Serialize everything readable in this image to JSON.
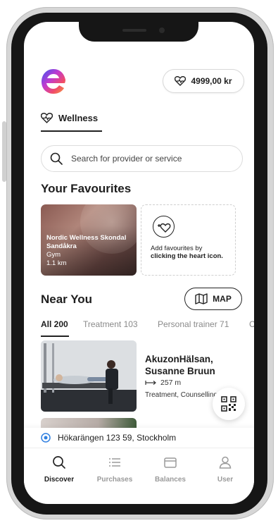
{
  "header": {
    "balance": "4999,00 kr",
    "category_tab": "Wellness"
  },
  "search": {
    "placeholder": "Search for provider or service"
  },
  "favourites": {
    "heading": "Your Favourites",
    "cards": [
      {
        "name": "Nordic Wellness Skondal Sandåkra",
        "type": "Gym",
        "distance": "1.1 km"
      }
    ],
    "add_card": {
      "text": "Add favourites by",
      "bold_text": "clicking the heart icon."
    }
  },
  "near_you": {
    "heading": "Near You",
    "map_label": "MAP",
    "filters": [
      {
        "label": "All 200",
        "active": true
      },
      {
        "label": "Treatment 103",
        "active": false
      },
      {
        "label": "Personal trainer 71",
        "active": false
      },
      {
        "label": "C",
        "active": false
      }
    ],
    "listings": [
      {
        "title_line1": "AkuzonHälsan,",
        "title_line2": "Susanne Bruun",
        "distance": "257 m",
        "tags": "Treatment, Counselling"
      }
    ]
  },
  "location": {
    "address": "Hökarängen 123 59, Stockholm"
  },
  "nav": {
    "items": [
      {
        "label": "Discover",
        "icon": "search-icon",
        "active": true
      },
      {
        "label": "Purchases",
        "icon": "list-icon",
        "active": false
      },
      {
        "label": "Balances",
        "icon": "wallet-icon",
        "active": false
      },
      {
        "label": "User",
        "icon": "user-icon",
        "active": false
      }
    ]
  },
  "colors": {
    "logo_gradient": [
      "#3a55f0",
      "#c03ad0",
      "#f04a6a",
      "#f5a13a"
    ],
    "text": "#1e1e1e",
    "muted": "#8a8a8a"
  }
}
